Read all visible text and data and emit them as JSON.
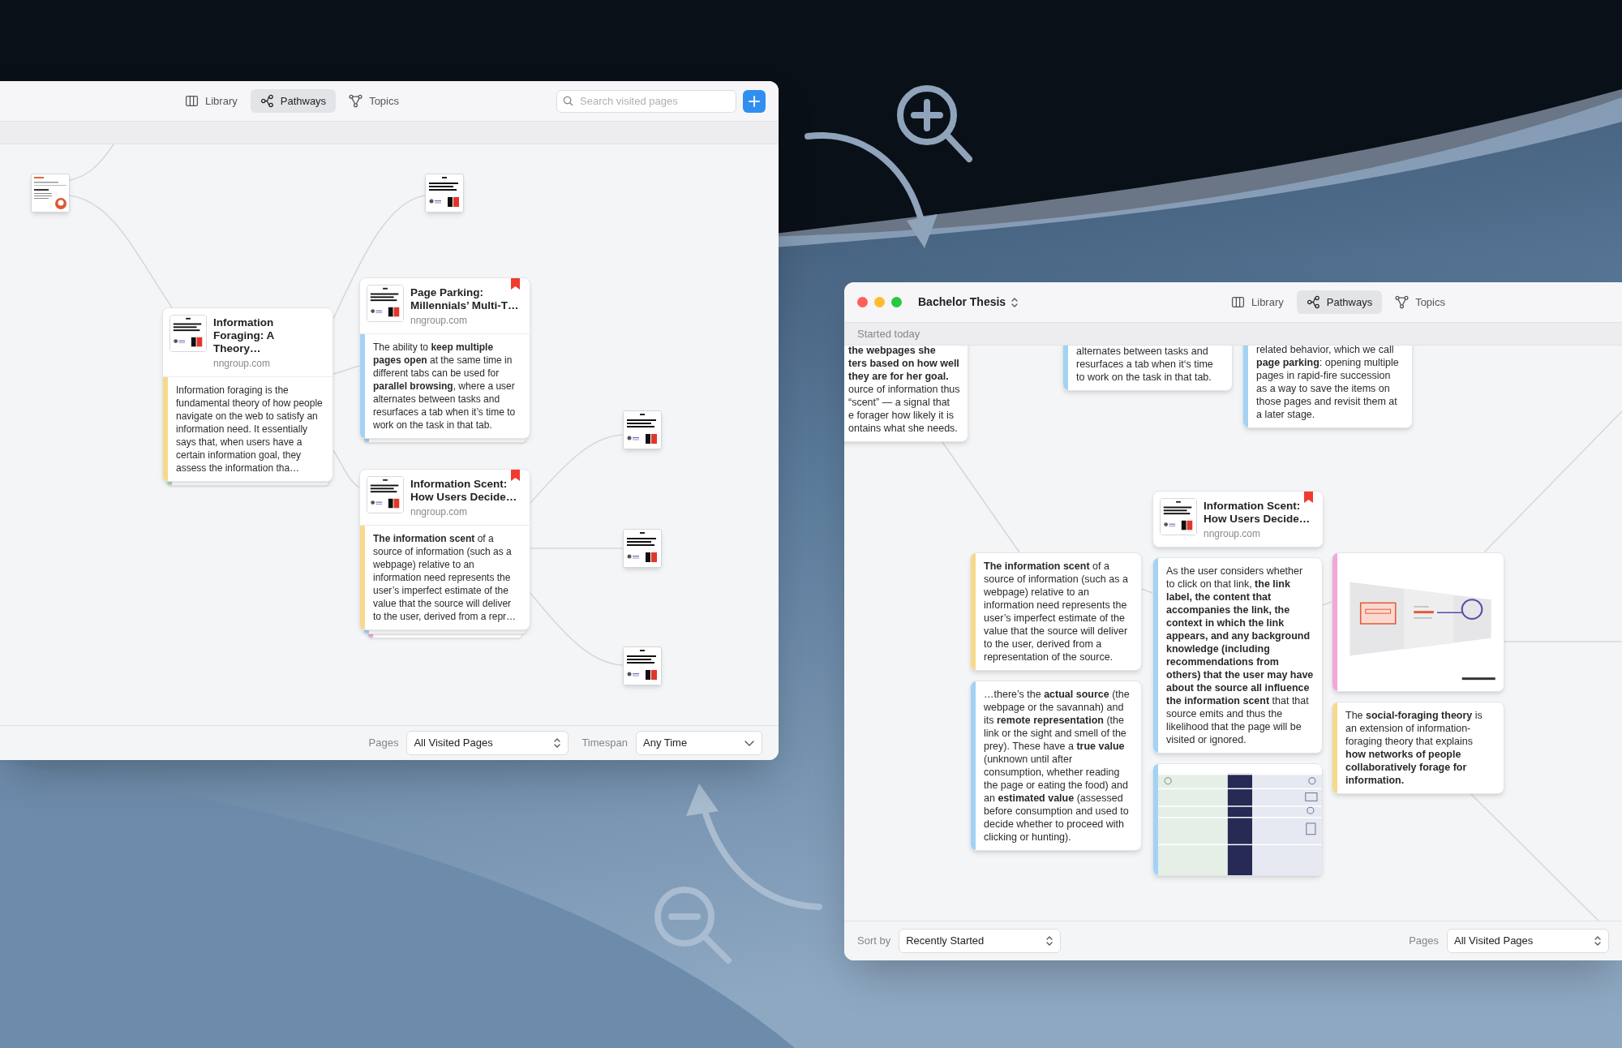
{
  "windows": [
    {
      "tabs": [
        {
          "label": "Library",
          "selected": false
        },
        {
          "label": "Pathways",
          "selected": true
        },
        {
          "label": "Topics",
          "selected": false
        }
      ],
      "search": {
        "placeholder": "Search visited pages"
      },
      "nodes": [
        {
          "kind": "search_thumbnail"
        },
        {
          "kind": "article_thumbnail"
        },
        {
          "kind": "page",
          "title": "Information Foraging: A Theory…",
          "domain": "nngroup.com",
          "bookmarked": false,
          "highlights": [
            {
              "text": "Information foraging is the fundamental theory of how people navigate on the web to satisfy an information need. It essentially says that, when users have a certain information goal, they assess the information tha…",
              "color": "#f7d98b"
            }
          ],
          "stack": [
            {
              "color": "#a8dcae"
            }
          ]
        },
        {
          "kind": "page",
          "title": "Page Parking: Millennials’ Multi-T…",
          "domain": "nngroup.com",
          "bookmarked": true,
          "highlights": [
            {
              "text": "The ability to **keep multiple pages open** at the same time in different tabs can be used for **parallel browsing**, where a user alternates between tasks and resurfaces a tab when it’s time to work on the task in that tab.",
              "color": "#a3d2f4"
            }
          ],
          "stack": [
            {
              "color": "#a3d2f4"
            }
          ]
        },
        {
          "kind": "page",
          "title": "Information Scent: How Users Decide…",
          "domain": "nngroup.com",
          "bookmarked": true,
          "highlights": [
            {
              "text": "**The information scent** of a source of information (such as a webpage) relative to an information need represents the user’s imperfect estimate of the value that the source will deliver to the user, derived from a repr…",
              "color": "#f7d98b"
            }
          ],
          "stack": [
            {
              "color": "#a3d2f4"
            },
            {
              "color": "#f4a6d7"
            }
          ]
        },
        {
          "kind": "article_thumbnail"
        },
        {
          "kind": "article_thumbnail"
        },
        {
          "kind": "article_thumbnail"
        }
      ],
      "footer": [
        {
          "label": "Pages",
          "value": "All Visited Pages",
          "kind": "stepper"
        },
        {
          "label": "Timespan",
          "value": "Any Time",
          "kind": "dropdown"
        }
      ]
    },
    {
      "title": "Bachelor Thesis",
      "tabs": [
        {
          "label": "Library",
          "selected": false
        },
        {
          "label": "Pathways",
          "selected": true
        },
        {
          "label": "Topics",
          "selected": false
        }
      ],
      "section_label": "Started today",
      "nodes": [
        {
          "kind": "highlight",
          "lines": [
            "**the webpages she**",
            "**ters based on how well**",
            "**they are for her goal.**",
            "ource of information thus",
            "“scent” — a signal that",
            "e forager how likely it is",
            "ontains what she needs."
          ]
        },
        {
          "kind": "highlight",
          "lines": [
            "alternates between tasks and",
            "resurfaces a tab when it‘s time",
            "to work on the task in that tab."
          ],
          "color": "#a3d2f4"
        },
        {
          "kind": "highlight",
          "lines": [
            "related behavior, which we call",
            "**page parking**: opening multiple",
            "pages in rapid-fire succession",
            "as a way to save the items on",
            "those pages and revisit them at",
            "a later stage."
          ],
          "color": "#a3d2f4"
        },
        {
          "kind": "page",
          "title": "Information Scent: How Users Decide…",
          "domain": "nngroup.com",
          "bookmarked": true
        },
        {
          "kind": "highlight",
          "text": "**The information scent** of a source of information (such as a webpage) relative to an information need represents the user’s imperfect estimate of the value that the source will deliver to the user, derived from a representation of the source.",
          "color": "#f7d98b"
        },
        {
          "kind": "highlight",
          "text": "…there’s the **actual source** (the webpage or the savannah) and its **remote representation** (the link or the sight and smell of the prey). These have a **true value** (unknown until after consumption, whether reading the page or eating the food) and an **estimated value** (assessed before consumption and used to decide whether to proceed with clicking or hunting).",
          "color": "#a3d2f4"
        },
        {
          "kind": "highlight",
          "text": "As the user considers whether to click on that link, **the link label, the content that accompanies the link, the context in which the link appears, and any background knowledge (including recommendations from others) that the user may have about the source all influence the information scent** that that source emits and thus the likelihood that the page will be visited or ignored.",
          "color": "#a3d2f4"
        },
        {
          "kind": "picture",
          "color": "#a3d2f4"
        },
        {
          "kind": "picture",
          "color": "#f4a6d7"
        },
        {
          "kind": "highlight",
          "text": "The **social-foraging theory** is an extension of information-foraging theory that explains **how networks of people collaboratively forage for information.**",
          "color": "#f7d98b"
        }
      ],
      "footer": [
        {
          "label": "Sort by",
          "value": "Recently Started",
          "kind": "stepper"
        },
        {
          "label": "Pages",
          "value": "All Visited Pages",
          "kind": "stepper"
        }
      ]
    }
  ]
}
